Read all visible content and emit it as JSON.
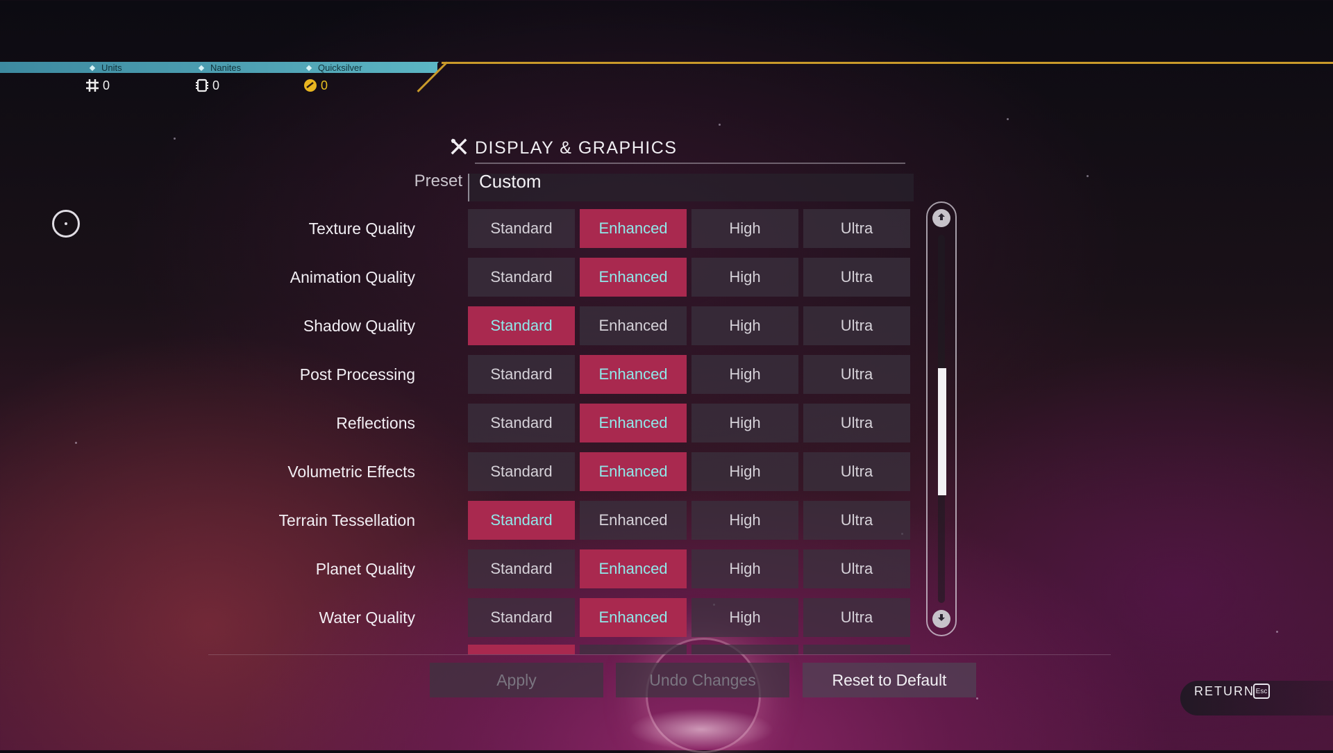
{
  "currencies": [
    {
      "label": "Units",
      "value": "0",
      "icon": "units-icon"
    },
    {
      "label": "Nanites",
      "value": "0",
      "icon": "nanites-icon"
    },
    {
      "label": "Quicksilver",
      "value": "0",
      "icon": "quicksilver-icon"
    }
  ],
  "header": {
    "title": "DISPLAY & GRAPHICS",
    "icon": "tools-icon"
  },
  "preset": {
    "label": "Preset",
    "value": "Custom"
  },
  "options": [
    "Standard",
    "Enhanced",
    "High",
    "Ultra"
  ],
  "settings": [
    {
      "label": "Texture Quality",
      "selected": "Enhanced"
    },
    {
      "label": "Animation Quality",
      "selected": "Enhanced"
    },
    {
      "label": "Shadow Quality",
      "selected": "Standard"
    },
    {
      "label": "Post Processing",
      "selected": "Enhanced"
    },
    {
      "label": "Reflections",
      "selected": "Enhanced"
    },
    {
      "label": "Volumetric Effects",
      "selected": "Enhanced"
    },
    {
      "label": "Terrain Tessellation",
      "selected": "Standard"
    },
    {
      "label": "Planet Quality",
      "selected": "Enhanced"
    },
    {
      "label": "Water Quality",
      "selected": "Enhanced"
    }
  ],
  "actions": {
    "apply": "Apply",
    "undo": "Undo Changes",
    "reset": "Reset to Default"
  },
  "return": {
    "label": "RETURN",
    "key": "Esc"
  },
  "colors": {
    "selected": "#a9294f",
    "selected_text": "#8fe9ea",
    "accent_gold": "#c99a2a",
    "currency_bar": "#4fa2b4"
  }
}
